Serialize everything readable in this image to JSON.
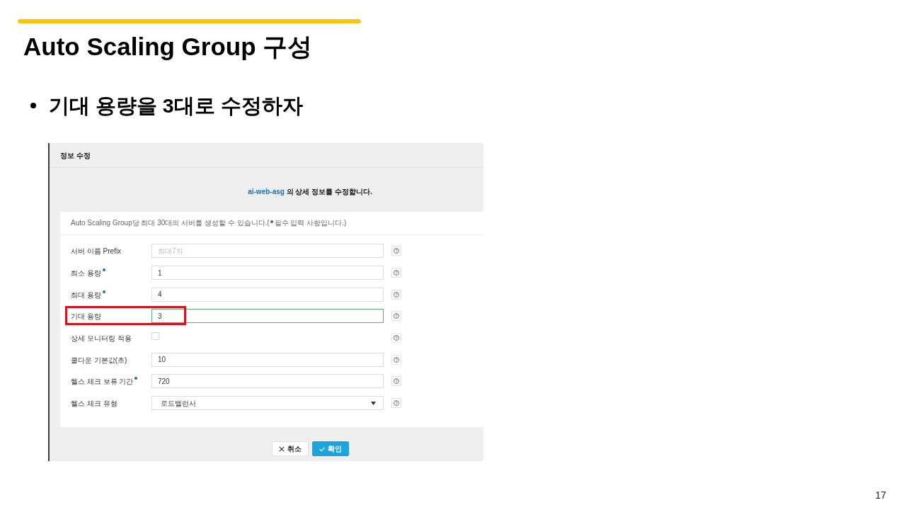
{
  "title": "Auto Scaling Group 구성",
  "bullets": [
    "기대 용량을 3대로 수정하자"
  ],
  "dialog": {
    "title": "정보 수정",
    "resource_name": "ai-web-asg",
    "description": "의 상세 정보를 수정합니다.",
    "notice": {
      "text": "Auto Scaling Group당 최대 30대의 서버를 생성할 수 있습니다.(",
      "legend": "필수 입력 사항입니다.)"
    },
    "fields": [
      {
        "label": "서버 이름 Prefix",
        "kind": "text",
        "required": false,
        "placeholder": "최대7자",
        "focused": false,
        "highlighted": false
      },
      {
        "label": "최소 용량",
        "kind": "text",
        "required": true,
        "value": "1",
        "focused": false,
        "highlighted": false
      },
      {
        "label": "최대 용량",
        "kind": "text",
        "required": true,
        "value": "4",
        "focused": false,
        "highlighted": false
      },
      {
        "label": "기대 용량",
        "kind": "text",
        "required": false,
        "value": "3",
        "focused": true,
        "highlighted": true
      },
      {
        "label": "상세 모니터링 적용",
        "kind": "checkbox",
        "required": false,
        "checked": false,
        "focused": false,
        "highlighted": false
      },
      {
        "label": "쿨다운 기본값(초)",
        "kind": "text",
        "required": false,
        "value": "10",
        "focused": false,
        "highlighted": false
      },
      {
        "label": "헬스 체크 보류 기간",
        "kind": "text",
        "required": true,
        "value": "720",
        "focused": false,
        "highlighted": false
      },
      {
        "label": "헬스 체크 유형",
        "kind": "select",
        "required": false,
        "value": "로드밸런서",
        "focused": false,
        "highlighted": false
      }
    ],
    "buttons": [
      {
        "label": "취소",
        "kind": "cancel"
      },
      {
        "label": "확인",
        "kind": "confirm"
      }
    ]
  },
  "page_number": "17"
}
